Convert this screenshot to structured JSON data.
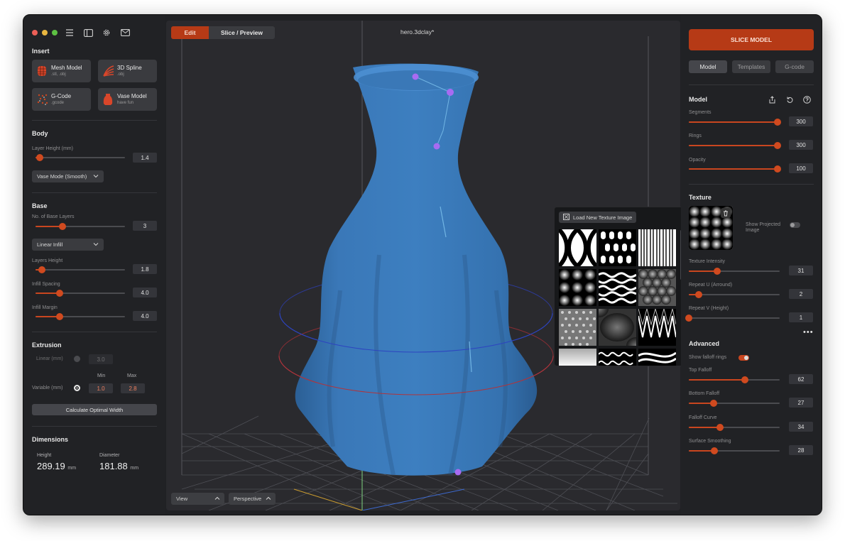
{
  "window": {
    "traffic_colors": [
      "#ec5f57",
      "#e8b640",
      "#5dc143"
    ]
  },
  "toolbar_icons": [
    "menu-icon",
    "sidebar-icon",
    "gear-icon",
    "mail-icon"
  ],
  "insert": {
    "title": "Insert",
    "items": [
      {
        "label": "Mesh Model",
        "sub": ".stl, .obj",
        "icon": "mesh-model-icon",
        "color": "#d9462a"
      },
      {
        "label": "3D Spline",
        "sub": ".obj",
        "icon": "spline-icon",
        "color": "#d9462a"
      },
      {
        "label": "G-Code",
        "sub": ".gcode",
        "icon": "gcode-icon",
        "color": "#c9461f"
      },
      {
        "label": "Vase Model",
        "sub": "have fun",
        "icon": "vase-icon",
        "color": "#d9462a"
      }
    ]
  },
  "body": {
    "title": "Body",
    "layer_height_label": "Layer Height (mm)",
    "layer_height_value": "1.4",
    "layer_height_level": 0.05,
    "mode_select": "Vase Mode (Smooth)"
  },
  "base": {
    "title": "Base",
    "base_layers_label": "No. of Base Layers",
    "base_layers_value": "3",
    "base_layers_level": 0.3,
    "infill_select": "Linear Infill",
    "layers_height_label": "Layers Height",
    "layers_height_value": "1.8",
    "layers_height_level": 0.07,
    "infill_spacing_label": "Infill Spacing",
    "infill_spacing_value": "4.0",
    "infill_spacing_level": 0.27,
    "infill_margin_label": "Infill Margin",
    "infill_margin_value": "4.0",
    "infill_margin_level": 0.27
  },
  "extrusion": {
    "title": "Extrusion",
    "linear_label": "Linear (mm)",
    "linear_value": "3.0",
    "min_label": "Min",
    "max_label": "Max",
    "variable_label": "Variable (mm)",
    "variable_min": "1.0",
    "variable_max": "2.8",
    "calc_button": "Calculate Optimal Width"
  },
  "dimensions": {
    "title": "Dimensions",
    "height_label": "Height",
    "height_value": "289.19",
    "height_unit": "mm",
    "diameter_label": "Diameter",
    "diameter_value": "181.88",
    "diameter_unit": "mm"
  },
  "viewport": {
    "edit_tab": "Edit",
    "slice_tab": "Slice / Preview",
    "filename": "hero.3dclay*",
    "view_select": "View",
    "perspective_select": "Perspective",
    "model_color": "#3a78b8"
  },
  "texture_popover": {
    "load_button": "Load New Texture Image"
  },
  "right": {
    "slice_button": "SLICE MODEL",
    "tabs": [
      "Model",
      "Templates",
      "G-code"
    ],
    "model_title": "Model",
    "segments_label": "Segments",
    "segments_value": "300",
    "segments_level": 0.98,
    "rings_label": "Rings",
    "rings_value": "300",
    "rings_level": 0.98,
    "opacity_label": "Opacity",
    "opacity_value": "100",
    "opacity_level": 0.98,
    "texture_title": "Texture",
    "show_projected_label": "Show Projected Image",
    "texture_intensity_label": "Texture Intensity",
    "texture_intensity_value": "31",
    "texture_intensity_level": 0.31,
    "repeat_u_label": "Repeat U (Arround)",
    "repeat_u_value": "2",
    "repeat_u_level": 0.11,
    "repeat_v_label": "Repeat V (Height)",
    "repeat_v_value": "1",
    "repeat_v_level": 0.0,
    "advanced_title": "Advanced",
    "show_falloff_label": "Show falloff rings",
    "top_falloff_label": "Top Falloff",
    "top_falloff_value": "62",
    "top_falloff_level": 0.62,
    "bottom_falloff_label": "Bottom Falloff",
    "bottom_falloff_value": "27",
    "bottom_falloff_level": 0.27,
    "falloff_curve_label": "Falloff Curve",
    "falloff_curve_value": "34",
    "falloff_curve_level": 0.34,
    "surface_smoothing_label": "Surface Smoothing",
    "surface_smoothing_value": "28",
    "surface_smoothing_level": 0.28
  },
  "accent_color": "#c9461f"
}
